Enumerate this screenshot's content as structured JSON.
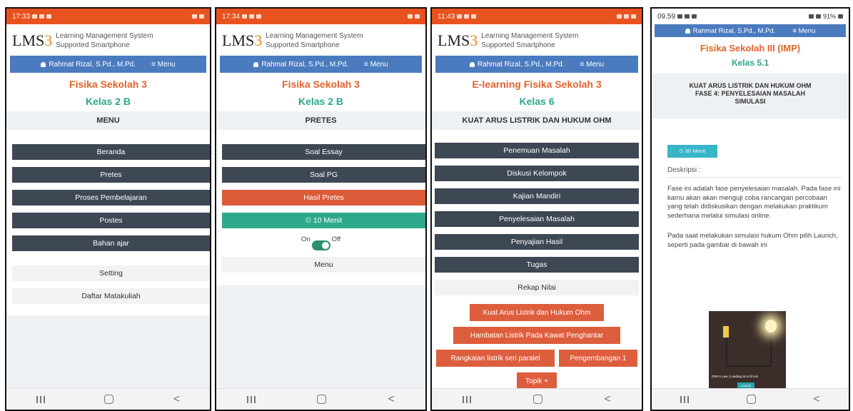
{
  "shared": {
    "logo_main": "LMS",
    "logo_three": "3",
    "logo_line1": "Learning Management System",
    "logo_line2": "Supported Smartphone",
    "user": "Rahmat Rizal, S.Pd., M.Pd.",
    "menu_label": "≡ Menu"
  },
  "phone1": {
    "time": "17:33",
    "course": "Fisika Sekolah 3",
    "kelas": "Kelas 2 B",
    "section": "MENU",
    "buttons": [
      "Beranda",
      "Pretes",
      "Proses Pembelajaran",
      "Postes",
      "Bahan ajar"
    ],
    "light_buttons": [
      "Setting",
      "Daftar Matakuliah"
    ]
  },
  "phone2": {
    "time": "17:34",
    "course": "Fisika Sekolah 3",
    "kelas": "Kelas 2 B",
    "section": "PRETES",
    "buttons": [
      "Soal Essay",
      "Soal PG"
    ],
    "active_button": "Hasil Pretes",
    "timer": "⏲ 10 Menit",
    "toggle_on": "On",
    "toggle_off": "Off",
    "menu_button": "Menu"
  },
  "phone3": {
    "time": "11:43",
    "course": "E-learning Fisika Sekolah 3",
    "kelas": "Kelas 6",
    "section": "KUAT ARUS LISTRIK DAN HUKUM OHM",
    "buttons": [
      "Penemuan Masalah",
      "Diskusi Kelompok",
      "Kajian Mandiri",
      "Penyelesaian Masalah",
      "Penyajian Hasil",
      "Tugas"
    ],
    "light_button": "Rekap Nilai",
    "topics": [
      "Kuat Arus Listrik dan Hukum Ohm",
      "Hambatan Listrik Pada Kawat Penghantar",
      "Rangkaian listrik seri paralel",
      "Pengembangan 1",
      "Topik +"
    ]
  },
  "phone4": {
    "time": "09.59",
    "battery": "91%",
    "course": "Fisika Sekolah III (IMP)",
    "kelas": "Kelas 5.1",
    "heading_line1": "KUAT ARUS LISTRIK DAN HUKUM OHM",
    "heading_line2": "FASE 4: PENYELESAIAN MASALAH",
    "heading_line3": "SIMULASI",
    "timer": "⏲ 30 Menit",
    "desc_label": "Deskripsi :",
    "para1": "Fase ini adalah fase penyelesaian masalah. Pada fase ini kamu akan akan menguji coba rancangan percobaan yang telah didiskusikan dengan melakukan praktikum sederhana melalui simulasi online.",
    "para2": "Pada saat melakukan simulasi hukum Ohm pilih Launch, seperti pada gambar di bawah ini",
    "sim_caption": "Ohm's Law | Loading at a Circuit",
    "sim_launch": "Launch"
  },
  "colors": {
    "status_orange": "#e8521f",
    "nav_blue": "#4b7bbf",
    "title_orange": "#e0632d",
    "title_green": "#2fa58b",
    "button_dark": "#3e4754",
    "button_red": "#db5a38",
    "button_teal": "#2fa98b"
  }
}
